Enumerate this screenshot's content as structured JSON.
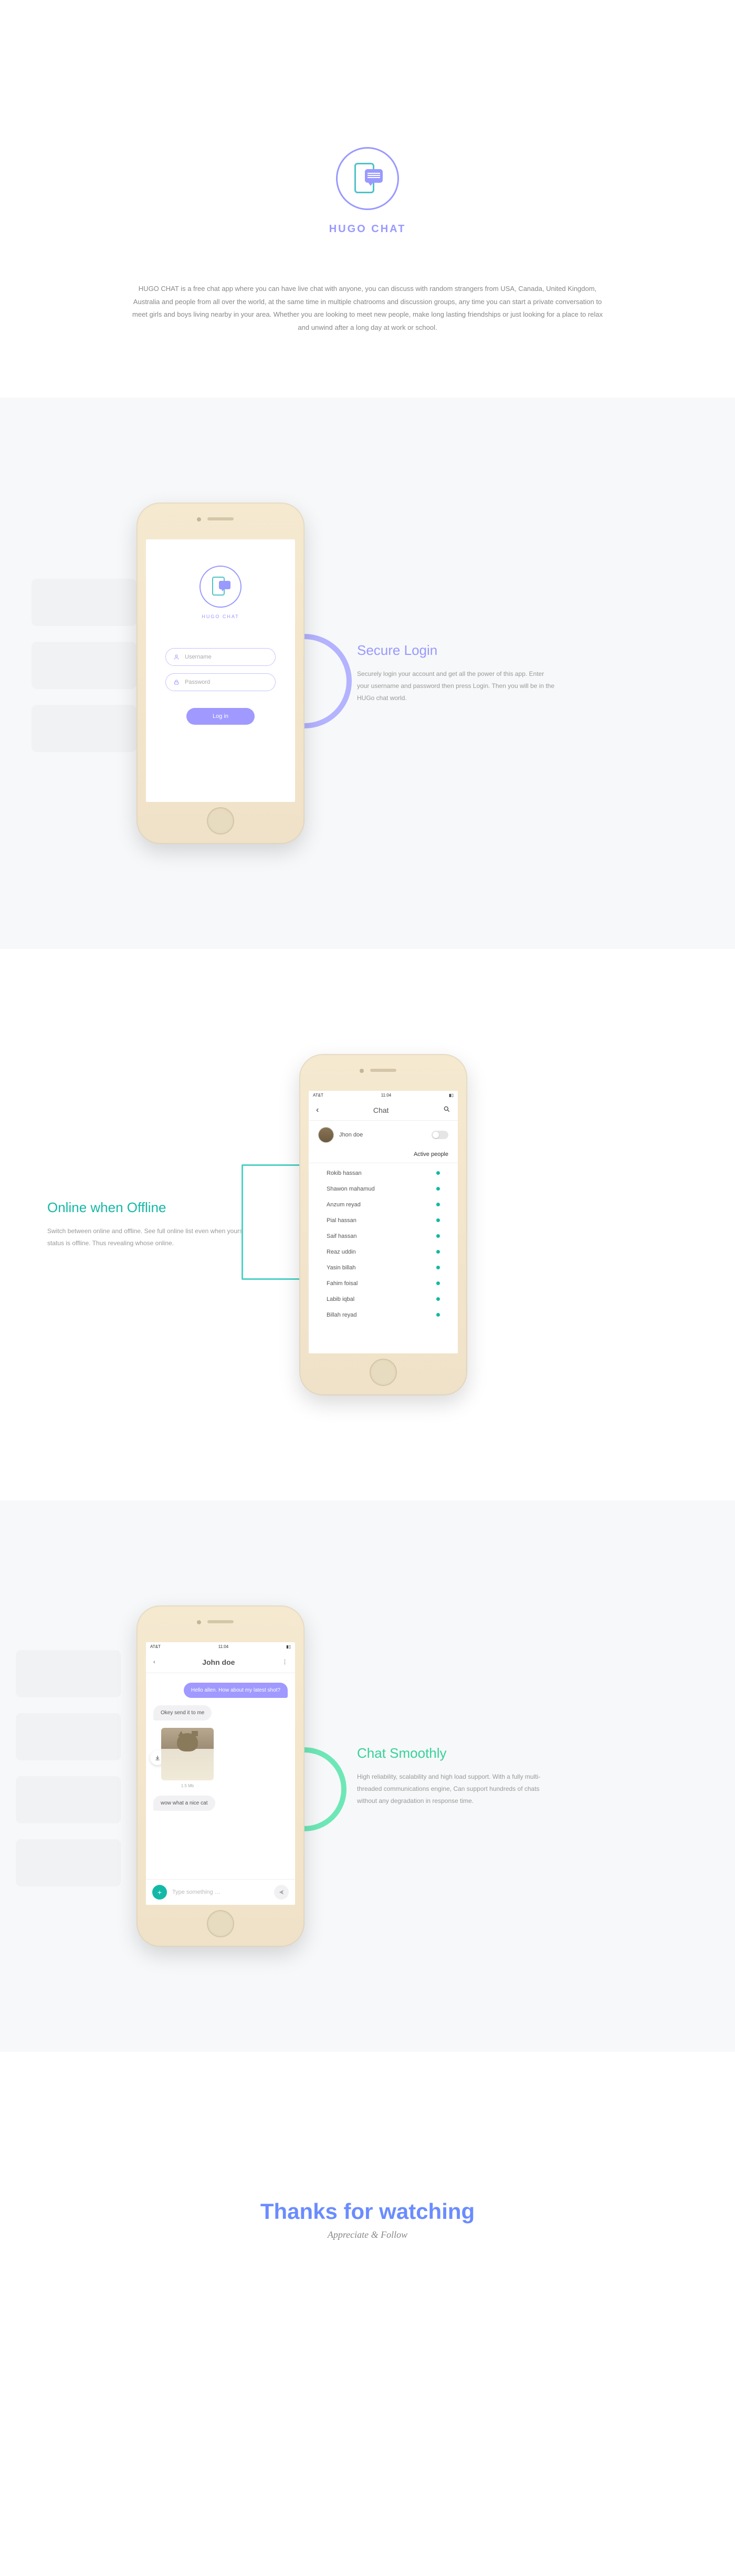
{
  "hero": {
    "title": "HUGO CHAT",
    "desc": "HUGO CHAT is a free chat app where you can have live chat with anyone, you can discuss with random strangers from USA, Canada, United Kingdom, Australia and people from all over the world, at the same time in multiple chatrooms and discussion groups, any time you can start a private conversation to meet girls and boys living nearby in your area. Whether you are looking to meet new people, make long lasting friendships or just looking for a place to relax and unwind after a long day at work or school."
  },
  "sec1": {
    "title": "Secure Login",
    "desc": "Securely login your account and get all the power of this app. Enter your username and password then press Login. Then you will be in the HUGo chat world.",
    "brand": "HUGO CHAT",
    "username_ph": "Username",
    "password_ph": "Password",
    "login_btn": "Log in"
  },
  "sec2": {
    "title": "Online when Offline",
    "desc": "Switch between online and offline. See full online list even when yours status is offline. Thus revealing whose online.",
    "screen_title": "Chat",
    "user": "Jhon doe",
    "active_label": "Active people",
    "people": [
      "Rokib hassan",
      "Shawon mahamud",
      "Anzum reyad",
      "Pial hassan",
      "Saif hassan",
      "Reaz uddin",
      "Yasin billah",
      "Fahim foisal",
      "Labib iqbal",
      "Billah reyad"
    ],
    "carrier": "AT&T",
    "time": "11:04"
  },
  "sec3": {
    "title": "Chat Smoothly",
    "desc": "High reliability, scalability and high load support. With a fully multi-threaded communications engine, Can support hundreds of chats without any degradation in response time.",
    "screen_title": "John doe",
    "msg1": "Hello allen. How about my latest shot?",
    "msg2": "Okey send it to me",
    "img_size": "1.5 Mb",
    "msg3": "wow what a nice cat",
    "input_ph": "Type something …",
    "carrier": "AT&T",
    "time": "11:04"
  },
  "footer": {
    "title": "Thanks for watching",
    "sub": "Appreciate & Follow"
  }
}
